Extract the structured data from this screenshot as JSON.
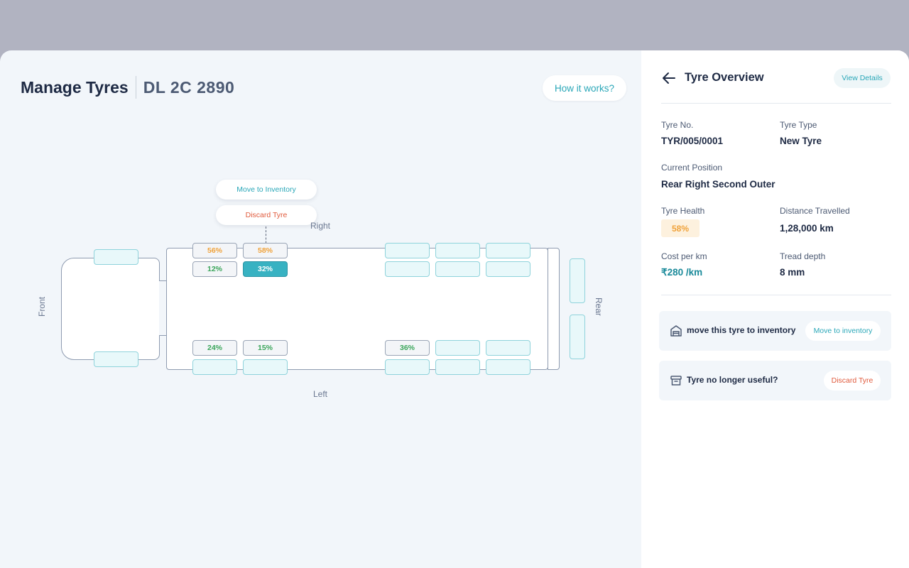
{
  "header": {
    "title": "Manage Tyres",
    "vehicle_number": "DL 2C 2890",
    "how_it_works": "How it works?"
  },
  "popover": {
    "move_label": "Move to Inventory",
    "discard_label": "Discard Tyre"
  },
  "diagram": {
    "right_label": "Right",
    "left_label": "Left",
    "front_label": "Front",
    "rear_label": "Rear",
    "tyres": {
      "r1_outer": "56%",
      "r2_outer": "58%",
      "r1_inner": "12%",
      "r2_inner": "32%",
      "l1_inner": "24%",
      "l2_inner": "15%",
      "l3_inner": "36%"
    }
  },
  "panel": {
    "title": "Tyre Overview",
    "view_details": "View Details",
    "fields": {
      "tyre_no_label": "Tyre No.",
      "tyre_no": "TYR/005/0001",
      "tyre_type_label": "Tyre Type",
      "tyre_type": "New Tyre",
      "position_label": "Current Position",
      "position": "Rear Right Second Outer",
      "health_label": "Tyre Health",
      "health": "58%",
      "distance_label": "Distance Travelled",
      "distance": "1,28,000 km",
      "cost_label": "Cost per km",
      "cost": "₹280 /km",
      "tread_label": "Tread depth",
      "tread": "8 mm"
    },
    "move_card": {
      "text": "move this tyre to inventory",
      "button": "Move to inventory"
    },
    "discard_card": {
      "text": "Tyre no longer useful?",
      "button": "Discard Tyre"
    }
  },
  "colors": {
    "accent": "#2aa7b8",
    "danger": "#e05a3c",
    "warning": "#f0a23a",
    "ok": "#3aa55a"
  }
}
